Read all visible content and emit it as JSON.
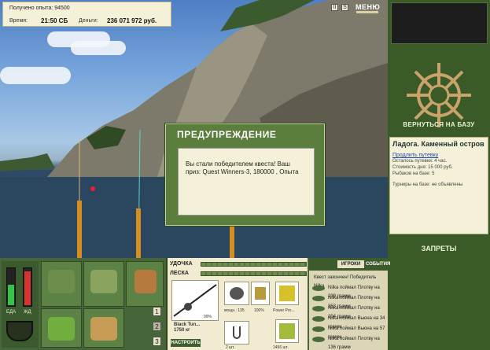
{
  "info": {
    "experience_label": "Получено опыта: 94500",
    "time_label": "Время:",
    "time_value": "21:50 СБ",
    "money_label": "Деньги:",
    "money_value": "236 071 972 руб."
  },
  "top": {
    "btn1": "II",
    "btn2": "S",
    "menu": "МЕНЮ"
  },
  "dialog": {
    "title": "ПРЕДУПРЕЖДЕНИЕ",
    "message": "Вы стали победителем квеста! Ваш приз: Quest Winners-3, 180000 , Опыта"
  },
  "right": {
    "return_base": "ВЕРНУТЬСЯ НА БАЗУ",
    "location_name": "Ладога. Каменный остров",
    "extend_link": "Продлить путевку",
    "days_left": "Осталось путевки: 4 час.",
    "day_cost": "Стоимость дня: 15 000 руб.",
    "fishers": "Рыбаков на базе: 5",
    "tournaments": "Турниры на базе: не объявлены",
    "bans": "ЗАПРЕТЫ"
  },
  "gauges": {
    "food_label": "ЕДА",
    "life_label": "ЖД",
    "food_level": 0.55,
    "life_level": 0.9
  },
  "pages": [
    "1",
    "2",
    "3"
  ],
  "tackle": {
    "rod_label": "УДОЧКА",
    "line_label": "ЛЕСКА",
    "rod_percent": "99%",
    "rod_name": "Black Tun...",
    "rod_weight": "1750 кг",
    "reel_caption1": "мощн.: 135",
    "reel_caption2": "100%",
    "line_name": "Power Pro...",
    "hook_count": "2 шт.",
    "bait_count": "1456 шт.",
    "setup_button": "НАСТРОИТЬ"
  },
  "events": {
    "tab_players": "ИГРОКИ",
    "tab_events": "СОБЫТИЯ",
    "items": [
      "Квест закончен! Победитель Nilka",
      "Nilka поймал Плотву на 239 грамм",
      "Nilka поймал Плотву на 353 грамм",
      "Nilka поймал Плотву на 204 грамм",
      "Nilka поймал Вьюна на 34 грамм",
      "Nilka поймал Вьюна на 57 грамм",
      "Nilka поймал Плотву на 136 грамм"
    ]
  }
}
